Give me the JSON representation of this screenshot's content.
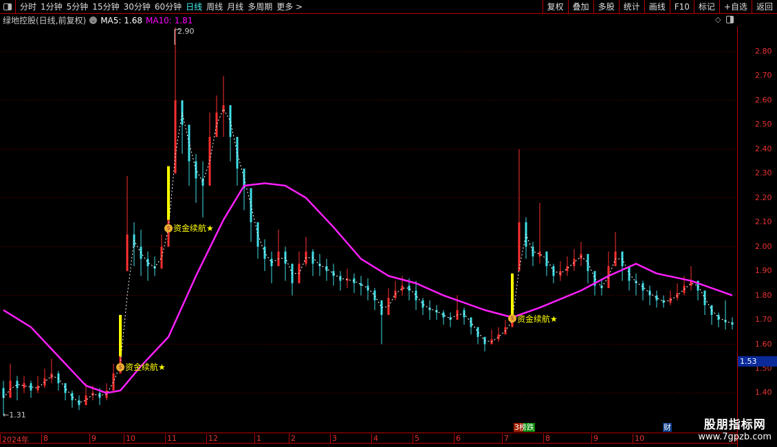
{
  "toolbar": {
    "periods": [
      "分时",
      "1分钟",
      "5分钟",
      "15分钟",
      "30分钟",
      "60分钟",
      "日线",
      "周线",
      "月线",
      "多周期",
      "更多 >"
    ],
    "active": "日线",
    "right_buttons": [
      "复权",
      "叠加",
      "多股",
      "统计",
      "画线",
      "F10",
      "标记",
      "+自选",
      "返回"
    ]
  },
  "title": {
    "stock": "绿地控股(日线,前复权)",
    "ma5": "MA5: 1.68",
    "ma10": "MA10: 1.81"
  },
  "colors": {
    "up": "#ff3030",
    "down": "#40e0e8",
    "flat": "#ffffff",
    "ma10": "#ff20ff",
    "ma5": "#ffffff",
    "signal": "#ffff00",
    "grid": "#8a0000"
  },
  "chart_data": {
    "type": "candlestick",
    "ylim": [
      1.33,
      2.95
    ],
    "yticks": [
      "2.80",
      "2.70",
      "2.60",
      "2.50",
      "2.40",
      "2.30",
      "2.20",
      "2.10",
      "2.00",
      "1.90",
      "1.80",
      "1.70",
      "1.60",
      "1.50",
      "1.40"
    ],
    "grid_values": [
      2.8,
      2.6,
      2.4,
      2.2,
      2.0,
      1.8,
      1.6,
      1.4
    ],
    "xticks": [
      {
        "i": 0,
        "label": "2024年"
      },
      {
        "i": 6,
        "label": "8"
      },
      {
        "i": 13,
        "label": "9"
      },
      {
        "i": 18,
        "label": "10"
      },
      {
        "i": 24,
        "label": "11"
      },
      {
        "i": 30,
        "label": "12"
      },
      {
        "i": 37,
        "label": "1"
      },
      {
        "i": 42,
        "label": "2"
      },
      {
        "i": 48,
        "label": "3"
      },
      {
        "i": 54,
        "label": "4"
      },
      {
        "i": 60,
        "label": "5"
      },
      {
        "i": 66,
        "label": "6"
      },
      {
        "i": 73,
        "label": "7"
      },
      {
        "i": 79,
        "label": "8"
      },
      {
        "i": 86,
        "label": "9"
      },
      {
        "i": 92,
        "label": "10"
      },
      {
        "i": 107,
        "label": "1"
      }
    ],
    "open": [
      1.42,
      1.38,
      1.45,
      1.42,
      1.44,
      1.41,
      1.43,
      1.46,
      1.48,
      1.44,
      1.4,
      1.37,
      1.35,
      1.39,
      1.4,
      1.38,
      1.41,
      1.48,
      1.9,
      2.05,
      2.0,
      1.95,
      1.92,
      1.91,
      2.0,
      2.3,
      2.6,
      2.5,
      2.35,
      2.28,
      2.25,
      2.45,
      2.55,
      2.58,
      2.45,
      2.32,
      2.24,
      2.1,
      2.0,
      1.95,
      1.92,
      1.98,
      1.93,
      1.85,
      1.93,
      1.98,
      1.93,
      1.92,
      1.9,
      1.88,
      1.86,
      1.87,
      1.85,
      1.84,
      1.82,
      1.78,
      1.72,
      1.79,
      1.82,
      1.84,
      1.82,
      1.78,
      1.75,
      1.74,
      1.73,
      1.71,
      1.7,
      1.74,
      1.71,
      1.67,
      1.63,
      1.6,
      1.62,
      1.64,
      1.67,
      1.9,
      2.1,
      2.0,
      1.96,
      1.98,
      1.92,
      1.88,
      1.9,
      1.92,
      1.95,
      1.97,
      1.9,
      1.84,
      1.83,
      1.92,
      1.98,
      1.92,
      1.86,
      1.85,
      1.82,
      1.8,
      1.78,
      1.77,
      1.79,
      1.81,
      1.84,
      1.86,
      1.82,
      1.76,
      1.72,
      1.7,
      1.69
    ],
    "high": [
      1.45,
      1.52,
      1.47,
      1.47,
      1.45,
      1.47,
      1.5,
      1.54,
      1.49,
      1.44,
      1.41,
      1.39,
      1.44,
      1.43,
      1.42,
      1.44,
      1.52,
      1.62,
      2.29,
      2.1,
      2.07,
      1.98,
      1.96,
      2.05,
      2.3,
      2.9,
      2.6,
      2.45,
      2.38,
      2.35,
      2.55,
      2.62,
      2.7,
      2.55,
      2.4,
      2.3,
      2.2,
      2.08,
      2.03,
      1.98,
      2.07,
      2.0,
      1.92,
      1.98,
      2.04,
      1.99,
      1.97,
      1.95,
      1.93,
      1.9,
      1.91,
      1.89,
      1.88,
      1.87,
      1.83,
      1.78,
      1.83,
      1.86,
      1.88,
      1.87,
      1.86,
      1.79,
      1.78,
      1.76,
      1.74,
      1.73,
      1.8,
      1.75,
      1.71,
      1.67,
      1.63,
      1.66,
      1.67,
      1.7,
      1.89,
      2.4,
      2.12,
      2.02,
      2.18,
      1.98,
      1.93,
      1.94,
      1.96,
      1.99,
      2.02,
      1.95,
      1.88,
      1.87,
      1.98,
      2.06,
      1.98,
      1.9,
      1.89,
      1.86,
      1.84,
      1.82,
      1.8,
      1.82,
      1.85,
      1.88,
      1.92,
      1.86,
      1.8,
      1.75,
      1.73,
      1.78,
      1.71
    ],
    "low": [
      1.31,
      1.38,
      1.37,
      1.4,
      1.38,
      1.4,
      1.42,
      1.44,
      1.41,
      1.37,
      1.34,
      1.33,
      1.36,
      1.37,
      1.35,
      1.37,
      1.41,
      1.5,
      1.9,
      1.92,
      1.88,
      1.86,
      1.88,
      1.93,
      2.05,
      2.45,
      2.38,
      2.25,
      2.18,
      2.12,
      2.3,
      2.45,
      2.45,
      2.35,
      2.25,
      2.15,
      2.02,
      1.95,
      1.9,
      1.85,
      1.92,
      1.86,
      1.8,
      1.88,
      1.92,
      1.88,
      1.88,
      1.86,
      1.84,
      1.82,
      1.83,
      1.81,
      1.8,
      1.78,
      1.74,
      1.6,
      1.74,
      1.78,
      1.8,
      1.78,
      1.74,
      1.72,
      1.7,
      1.7,
      1.68,
      1.67,
      1.7,
      1.68,
      1.64,
      1.6,
      1.57,
      1.6,
      1.61,
      1.64,
      1.68,
      1.95,
      1.95,
      1.92,
      1.93,
      1.88,
      1.85,
      1.86,
      1.88,
      1.9,
      1.92,
      1.85,
      1.8,
      1.8,
      1.85,
      1.92,
      1.86,
      1.82,
      1.8,
      1.78,
      1.76,
      1.75,
      1.75,
      1.76,
      1.78,
      1.8,
      1.82,
      1.78,
      1.72,
      1.68,
      1.67,
      1.66,
      1.66
    ],
    "close": [
      1.38,
      1.45,
      1.42,
      1.44,
      1.41,
      1.43,
      1.46,
      1.48,
      1.44,
      1.4,
      1.37,
      1.35,
      1.39,
      1.4,
      1.38,
      1.41,
      1.48,
      1.55,
      2.05,
      2.0,
      1.95,
      1.92,
      1.91,
      2.0,
      2.15,
      2.6,
      2.5,
      2.35,
      2.28,
      2.25,
      2.45,
      2.55,
      2.58,
      2.45,
      2.32,
      2.24,
      2.1,
      2.0,
      1.95,
      1.92,
      1.98,
      1.93,
      1.85,
      1.93,
      1.98,
      1.93,
      1.92,
      1.9,
      1.88,
      1.86,
      1.87,
      1.85,
      1.84,
      1.82,
      1.78,
      1.72,
      1.79,
      1.82,
      1.84,
      1.82,
      1.78,
      1.75,
      1.74,
      1.73,
      1.71,
      1.7,
      1.74,
      1.71,
      1.67,
      1.63,
      1.6,
      1.62,
      1.64,
      1.67,
      1.72,
      2.1,
      2.0,
      1.96,
      1.98,
      1.92,
      1.88,
      1.9,
      1.92,
      1.95,
      1.97,
      1.9,
      1.84,
      1.83,
      1.92,
      1.98,
      1.92,
      1.86,
      1.85,
      1.82,
      1.8,
      1.78,
      1.77,
      1.79,
      1.81,
      1.84,
      1.86,
      1.82,
      1.76,
      1.72,
      1.7,
      1.69,
      1.68
    ],
    "ma10": [
      [
        0,
        1.74
      ],
      [
        4,
        1.67
      ],
      [
        8,
        1.55
      ],
      [
        12,
        1.43
      ],
      [
        15,
        1.4
      ],
      [
        17,
        1.41
      ],
      [
        20,
        1.51
      ],
      [
        24,
        1.63
      ],
      [
        28,
        1.88
      ],
      [
        32,
        2.11
      ],
      [
        35,
        2.25
      ],
      [
        38,
        2.26
      ],
      [
        41,
        2.25
      ],
      [
        44,
        2.2
      ],
      [
        48,
        2.08
      ],
      [
        52,
        1.95
      ],
      [
        56,
        1.88
      ],
      [
        60,
        1.85
      ],
      [
        64,
        1.8
      ],
      [
        70,
        1.74
      ],
      [
        74,
        1.71
      ],
      [
        78,
        1.75
      ],
      [
        84,
        1.82
      ],
      [
        88,
        1.88
      ],
      [
        92,
        1.93
      ],
      [
        95,
        1.89
      ],
      [
        100,
        1.86
      ],
      [
        106,
        1.8
      ]
    ],
    "signals": [
      {
        "i": 17,
        "from": 1.55,
        "to": 1.72,
        "at": 1.51,
        "label": "资金续航★"
      },
      {
        "i": 24,
        "from": 2.11,
        "to": 2.33,
        "at": 2.08,
        "label": "资金续航★"
      },
      {
        "i": 74,
        "from": 1.72,
        "to": 1.89,
        "at": 1.71,
        "label": "资金续航★"
      }
    ],
    "annotations": {
      "max": "2.90",
      "min": "←1.31"
    },
    "current_price": "1.53"
  },
  "markers": {
    "event1": "3榜跌",
    "event2": "财"
  },
  "watermark": {
    "name": "股朋指标网",
    "url": "www.7gpzb.com"
  }
}
